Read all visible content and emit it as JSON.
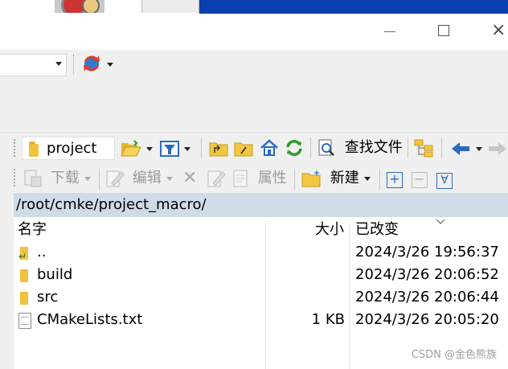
{
  "window": {
    "minimize_glyph": "",
    "close_glyph": "×"
  },
  "session_bar": {
    "sync_icon": "sync-icon",
    "session_value": ""
  },
  "toolbar1": {
    "folder_value": "project",
    "find_files_label": "查找文件",
    "icons": [
      "open-folder-icon",
      "filter-icon",
      "parent-folder-icon",
      "root-folder-icon",
      "home-icon",
      "refresh-icon",
      "find-icon",
      "tree-icon",
      "back-arrow-icon",
      "forward-arrow-icon"
    ]
  },
  "toolbar2": {
    "download_label": "下载",
    "edit_label": "编辑",
    "properties_label": "属性",
    "new_label": "新建",
    "plus_label": "+",
    "minus_label": "−",
    "select_label": "∀",
    "delete_label": "✕"
  },
  "path": "/root/cmke/project_macro/",
  "columns": {
    "name": "名字",
    "size": "大小",
    "modified": "已改变"
  },
  "files": [
    {
      "name": "..",
      "size": "",
      "modified": "2024/3/26 19:56:37",
      "type": "parent"
    },
    {
      "name": "build",
      "size": "",
      "modified": "2024/3/26 20:06:52",
      "type": "folder"
    },
    {
      "name": "src",
      "size": "",
      "modified": "2024/3/26 20:06:44",
      "type": "folder"
    },
    {
      "name": "CMakeLists.txt",
      "size": "1 KB",
      "modified": "2024/3/26 20:05:20",
      "type": "file"
    }
  ],
  "watermark": "CSDN @金色熊族",
  "colors": {
    "path_bar": "#cfdbe7",
    "toolbar_bg": "#f0f0f0",
    "desktop_blue": "#0a3fae",
    "folder": "#f2c13d"
  }
}
